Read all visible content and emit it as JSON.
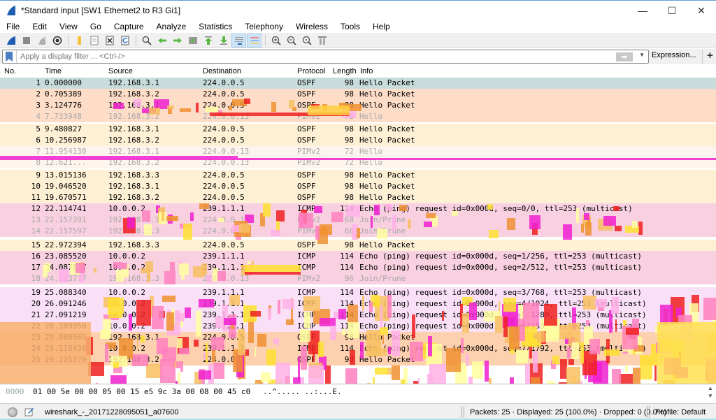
{
  "window": {
    "title": "*Standard input [SW1 Ethernet2 to R3 Gi1]",
    "minimize": "—",
    "maximize": "☐",
    "close": "✕"
  },
  "menu": [
    "File",
    "Edit",
    "View",
    "Go",
    "Capture",
    "Analyze",
    "Statistics",
    "Telephony",
    "Wireless",
    "Tools",
    "Help"
  ],
  "toolbar": {
    "icons": [
      "start-capture-icon",
      "stop-capture-icon",
      "restart-capture-icon",
      "capture-options-icon",
      "open-file-icon",
      "save-file-icon",
      "close-file-icon",
      "reload-file-icon",
      "find-packet-icon",
      "go-back-icon",
      "go-forward-icon",
      "go-to-packet-icon",
      "go-first-icon",
      "go-last-icon",
      "auto-scroll-icon",
      "colorize-icon",
      "zoom-in-icon",
      "zoom-out-icon",
      "zoom-normal-icon",
      "resize-columns-icon"
    ]
  },
  "filter": {
    "placeholder": "Apply a display filter ... <Ctrl-/>",
    "value": "",
    "expression_label": "Expression...",
    "add_label": "+"
  },
  "columns": {
    "no": "No.",
    "time": "Time",
    "source": "Source",
    "destination": "Destination",
    "protocol": "Protocol",
    "length": "Length",
    "info": "Info"
  },
  "packets": [
    {
      "no": "1",
      "time": "0.000000",
      "src": "192.168.3.1",
      "dst": "224.0.0.5",
      "proto": "OSPF",
      "len": "98",
      "info": "Hello Packet",
      "bg": "#c8dcdc",
      "faded": false
    },
    {
      "no": "2",
      "time": "0.705389",
      "src": "192.168.3.2",
      "dst": "224.0.0.5",
      "proto": "OSPF",
      "len": "98",
      "info": "Hello Packet",
      "bg": "#fddcc8",
      "faded": false
    },
    {
      "no": "3",
      "time": "3.124776",
      "src": "192.168.3.1",
      "dst": "224.0.0.5",
      "proto": "OSPF",
      "len": "98",
      "info": "Hello Packet",
      "bg": "#fddcc8",
      "faded": false
    },
    {
      "no": "4",
      "time": "7.733948",
      "src": "192.168.3.2",
      "dst": "224.0.0.13",
      "proto": "PIMv2",
      "len": "72",
      "info": "Hello",
      "bg": "#fddcc8",
      "faded": true
    },
    {
      "no": "5",
      "time": "9.480827",
      "src": "192.168.3.1",
      "dst": "224.0.0.5",
      "proto": "OSPF",
      "len": "98",
      "info": "Hello Packet",
      "bg": "#fdf0d4",
      "faded": false
    },
    {
      "no": "6",
      "time": "10.256987",
      "src": "192.168.3.2",
      "dst": "224.0.0.5",
      "proto": "OSPF",
      "len": "98",
      "info": "Hello Packet",
      "bg": "#fdf0d4",
      "faded": false
    },
    {
      "no": "7",
      "time": "11.954130",
      "src": "192.168.3.1",
      "dst": "224.0.0.13",
      "proto": "PIMv2",
      "len": "72",
      "info": "Hello",
      "bg": "#fdf4ee",
      "faded": true
    },
    {
      "no": "8",
      "time": "12.621...",
      "src": "192.168.3.2",
      "dst": "224.0.0.13",
      "proto": "PIMv2",
      "len": "72",
      "info": "Hello",
      "bg": "#fdf4ee",
      "faded": true
    },
    {
      "no": "9",
      "time": "13.015136",
      "src": "192.168.3.3",
      "dst": "224.0.0.5",
      "proto": "OSPF",
      "len": "98",
      "info": "Hello Packet",
      "bg": "#fdf0d4",
      "faded": false
    },
    {
      "no": "10",
      "time": "19.046520",
      "src": "192.168.3.1",
      "dst": "224.0.0.5",
      "proto": "OSPF",
      "len": "98",
      "info": "Hello Packet",
      "bg": "#fdf0d4",
      "faded": false
    },
    {
      "no": "11",
      "time": "19.670571",
      "src": "192.168.3.2",
      "dst": "224.0.0.5",
      "proto": "OSPF",
      "len": "98",
      "info": "Hello Packet",
      "bg": "#fdf0d4",
      "faded": false
    },
    {
      "no": "12",
      "time": "22.114741",
      "src": "10.0.0.2",
      "dst": "239.1.1.1",
      "proto": "ICMP",
      "len": "114",
      "info": "Echo (ping) request  id=0x000d, seq=0/0, ttl=253 (multicast)",
      "bg": "#f8d0e0",
      "faded": false
    },
    {
      "no": "13",
      "time": "22.157391",
      "src": "192.168.3.3",
      "dst": "224.0.0.13",
      "proto": "PIMv2",
      "len": "68",
      "info": "Join/Prune",
      "bg": "#f8d0e0",
      "faded": true
    },
    {
      "no": "14",
      "time": "22.157597",
      "src": "192.168.3.3",
      "dst": "224.0.0.13",
      "proto": "PIMv2",
      "len": "68",
      "info": "Join/Prune",
      "bg": "#f8d0e0",
      "faded": true
    },
    {
      "no": "15",
      "time": "22.972394",
      "src": "192.168.3.3",
      "dst": "224.0.0.5",
      "proto": "OSPF",
      "len": "98",
      "info": "Hello Packet",
      "bg": "#fdf0d4",
      "faded": false
    },
    {
      "no": "16",
      "time": "23.085520",
      "src": "10.0.0.2",
      "dst": "239.1.1.1",
      "proto": "ICMP",
      "len": "114",
      "info": "Echo (ping) request  id=0x000d, seq=1/256, ttl=253 (multicast)",
      "bg": "#f8d0e0",
      "faded": false
    },
    {
      "no": "17",
      "time": "24.087827",
      "src": "10.0.0.2",
      "dst": "239.1.1.1",
      "proto": "ICMP",
      "len": "114",
      "info": "Echo (ping) request  id=0x000d, seq=2/512, ttl=253 (multicast)",
      "bg": "#f8d0e0",
      "faded": false
    },
    {
      "no": "18",
      "time": "24.723777",
      "src": "192.168.3.3",
      "dst": "224.0.0.13",
      "proto": "PIMv2",
      "len": "96",
      "info": "Join/Prune",
      "bg": "#f8d0e0",
      "faded": true
    },
    {
      "no": "19",
      "time": "25.088340",
      "src": "10.0.0.2",
      "dst": "239.1.1.1",
      "proto": "ICMP",
      "len": "114",
      "info": "Echo (ping) request  id=0x000d, seq=3/768, ttl=253 (multicast)",
      "bg": "#fae0f6",
      "faded": false
    },
    {
      "no": "20",
      "time": "26.091246",
      "src": "10.0.0.2",
      "dst": "239.1.1.1",
      "proto": "ICMP",
      "len": "114",
      "info": "Echo (ping) request  id=0x000d, seq=4/1024, ttl=253 (multicast)",
      "bg": "#fae0f6",
      "faded": false
    },
    {
      "no": "21",
      "time": "27.091219",
      "src": "10.0.0.2",
      "dst": "239.1.1.1",
      "proto": "ICMP",
      "len": "114",
      "info": "Echo (ping) request  id=0x000d, seq=5/1280, ttl=253 (multicast)",
      "bg": "#fae0f6",
      "faded": false
    },
    {
      "no": "22",
      "time": "28.109958",
      "src": "10.0.0.2",
      "dst": "239.1.1.1",
      "proto": "ICMP",
      "len": "114",
      "info": "Echo (ping) request  id=0x000d, seq=6/1536, ttl=253 (multicast)",
      "bg": "#fae0f6",
      "faded": false
    },
    {
      "no": "23",
      "time": "29.000065",
      "src": "192.168.3.1",
      "dst": "224.0.0.5",
      "proto": "OSPF",
      "len": "98",
      "info": "Hello Packet",
      "bg": "#fdd0b0",
      "faded": false
    },
    {
      "no": "24",
      "time": "29.118436",
      "src": "10.0.0.2",
      "dst": "239.1.1.1",
      "proto": "ICMP",
      "len": "114",
      "info": "Echo (ping) request  id=0x000d, seq=7/1792, ttl=253 (multicast)",
      "bg": "#fdd0b0",
      "faded": false
    },
    {
      "no": "25",
      "time": "29.225379",
      "src": "192.168.3.2",
      "dst": "224.0.0.5",
      "proto": "OSPF",
      "len": "98",
      "info": "Hello Packet",
      "bg": "#fdd0b0",
      "faded": false
    }
  ],
  "hex": {
    "offset": "0000",
    "bytes": "01 00 5e 00 00 05 00 15  e5 9c 3a 00 08 00 45 c0",
    "ascii": "..^..... ..:...E."
  },
  "status": {
    "file": "wireshark_-_20171228095051_a07600",
    "packets": "Packets: 25 · Displayed: 25 (100.0%) · Dropped: 0 (0.0%)",
    "profile": "Profile: Default"
  },
  "colors": {
    "accent": "#4a7fc1",
    "glitch_magenta": "#f020d0",
    "glitch_red": "#f02020",
    "glitch_yellow": "#ffe030",
    "glitch_orange": "#f09030"
  }
}
